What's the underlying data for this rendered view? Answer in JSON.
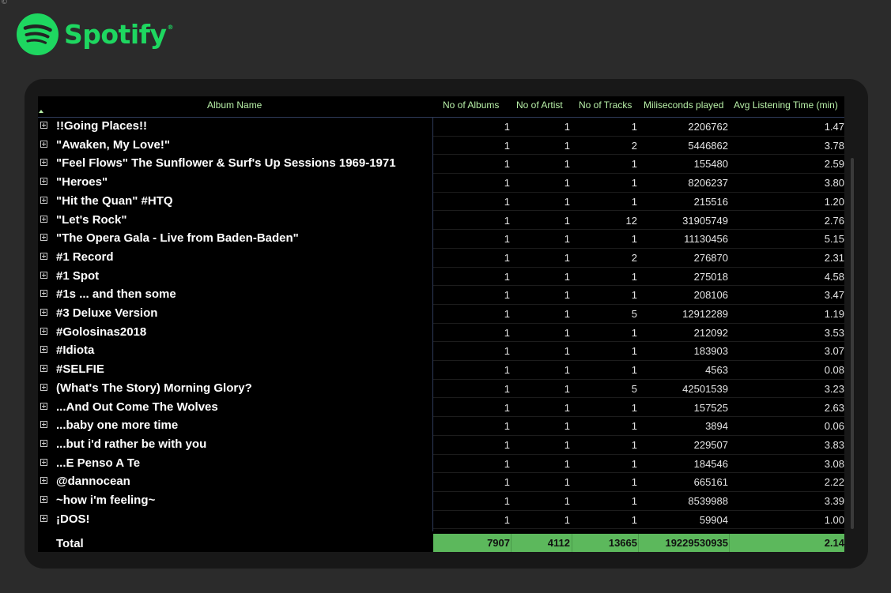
{
  "brand": {
    "name": "Spotify",
    "trademark": "®",
    "color": "#1ed760"
  },
  "table": {
    "columns": {
      "album_name": "Album Name",
      "albums": "No of Albums",
      "artists": "No of Artist",
      "tracks": "No of Tracks",
      "ms_played": "Miliseconds played",
      "avg_time": "Avg Listening Time (min)"
    },
    "rows": [
      {
        "album": "!!Going Places!!",
        "albums": "1",
        "artists": "1",
        "tracks": "1",
        "ms": "2206762",
        "avg": "1.47"
      },
      {
        "album": "\"Awaken, My Love!\"",
        "albums": "1",
        "artists": "1",
        "tracks": "2",
        "ms": "5446862",
        "avg": "3.78"
      },
      {
        "album": "\"Feel Flows\" The Sunflower & Surf's Up Sessions 1969-1971",
        "albums": "1",
        "artists": "1",
        "tracks": "1",
        "ms": "155480",
        "avg": "2.59"
      },
      {
        "album": "\"Heroes\"",
        "albums": "1",
        "artists": "1",
        "tracks": "1",
        "ms": "8206237",
        "avg": "3.80"
      },
      {
        "album": "\"Hit the Quan\" #HTQ",
        "albums": "1",
        "artists": "1",
        "tracks": "1",
        "ms": "215516",
        "avg": "1.20"
      },
      {
        "album": "\"Let's Rock\"",
        "albums": "1",
        "artists": "1",
        "tracks": "12",
        "ms": "31905749",
        "avg": "2.76"
      },
      {
        "album": "\"The Opera Gala - Live from Baden-Baden\"",
        "albums": "1",
        "artists": "1",
        "tracks": "1",
        "ms": "11130456",
        "avg": "5.15"
      },
      {
        "album": "#1 Record",
        "albums": "1",
        "artists": "1",
        "tracks": "2",
        "ms": "276870",
        "avg": "2.31"
      },
      {
        "album": "#1 Spot",
        "albums": "1",
        "artists": "1",
        "tracks": "1",
        "ms": "275018",
        "avg": "4.58"
      },
      {
        "album": "#1s ... and then some",
        "albums": "1",
        "artists": "1",
        "tracks": "1",
        "ms": "208106",
        "avg": "3.47"
      },
      {
        "album": "#3 Deluxe Version",
        "albums": "1",
        "artists": "1",
        "tracks": "5",
        "ms": "12912289",
        "avg": "1.19"
      },
      {
        "album": "#Golosinas2018",
        "albums": "1",
        "artists": "1",
        "tracks": "1",
        "ms": "212092",
        "avg": "3.53"
      },
      {
        "album": "#Idiota",
        "albums": "1",
        "artists": "1",
        "tracks": "1",
        "ms": "183903",
        "avg": "3.07"
      },
      {
        "album": "#SELFIE",
        "albums": "1",
        "artists": "1",
        "tracks": "1",
        "ms": "4563",
        "avg": "0.08"
      },
      {
        "album": "(What's The Story) Morning Glory?",
        "albums": "1",
        "artists": "1",
        "tracks": "5",
        "ms": "42501539",
        "avg": "3.23"
      },
      {
        "album": "...And Out Come The Wolves",
        "albums": "1",
        "artists": "1",
        "tracks": "1",
        "ms": "157525",
        "avg": "2.63"
      },
      {
        "album": "...baby one more time",
        "albums": "1",
        "artists": "1",
        "tracks": "1",
        "ms": "3894",
        "avg": "0.06"
      },
      {
        "album": "...but i'd rather be with you",
        "albums": "1",
        "artists": "1",
        "tracks": "1",
        "ms": "229507",
        "avg": "3.83"
      },
      {
        "album": "...E Penso A Te",
        "albums": "1",
        "artists": "1",
        "tracks": "1",
        "ms": "184546",
        "avg": "3.08"
      },
      {
        "album": "@dannocean",
        "albums": "1",
        "artists": "1",
        "tracks": "1",
        "ms": "665161",
        "avg": "2.22"
      },
      {
        "album": "~how i'm feeling~",
        "albums": "1",
        "artists": "1",
        "tracks": "1",
        "ms": "8539988",
        "avg": "3.39"
      },
      {
        "album": "¡DOS!",
        "albums": "1",
        "artists": "1",
        "tracks": "1",
        "ms": "59904",
        "avg": "1.00"
      }
    ],
    "total": {
      "label": "Total",
      "albums": "7907",
      "artists": "4112",
      "tracks": "13665",
      "ms": "19229530935",
      "avg": "2.14"
    },
    "total_color": "#5cb85c",
    "header_color": "#b8f0a8"
  }
}
